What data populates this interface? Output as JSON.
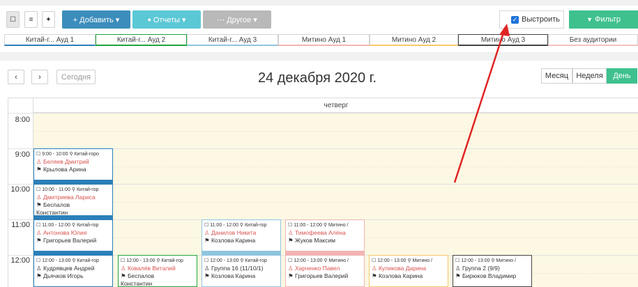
{
  "toolbar": {
    "view_icons": [
      "calendar-grid-icon",
      "list-icon",
      "graduation-icon"
    ],
    "add_label": "+ Добавить ▾",
    "reports_label": "Отчеты ▾",
    "other_label": "⋯ Другое ▾",
    "build_label": "Выстроить",
    "build_checked": true,
    "filter_label": "Фильтр"
  },
  "rooms": [
    {
      "label": "Китай-г... Ауд 1",
      "color": "#2c7fb8"
    },
    {
      "label": "Китай-г... Ауд 2",
      "color": "#1fa53b"
    },
    {
      "label": "Китай-г... Ауд 3",
      "color": "#8fc5e0"
    },
    {
      "label": "Митино Ауд 1",
      "color": "#f3b3b3"
    },
    {
      "label": "Митино Ауд 2",
      "color": "#f6c86a"
    },
    {
      "label": "Митино Ауд 3",
      "color": "#444444"
    },
    {
      "label": "Без аудитории",
      "color": "#f3c1c1"
    }
  ],
  "calendar": {
    "prev": "‹",
    "next": "›",
    "today_label": "Сегодня",
    "title": "24 декабря 2020 г.",
    "views": [
      "Месяц",
      "Неделя",
      "День"
    ],
    "active_view": "День",
    "day_label": "четверг",
    "hours": [
      "8:00",
      "9:00",
      "10:00",
      "11:00",
      "12:00"
    ]
  },
  "events": [
    {
      "time": "9:00 - 10:00 ⚲ Китай-горо",
      "teacher": "Беляев Дмитрий",
      "student": "Крылова Арина",
      "student2": "",
      "color": "#2c7fb8",
      "hour": 1,
      "col": 0
    },
    {
      "time": "10:00 - 11:00 ⚲ Китай-гор",
      "teacher": "Дмитриева Лариса",
      "student": "Беспалов",
      "student2": "Константин",
      "color": "#2c7fb8",
      "hour": 2,
      "col": 0
    },
    {
      "time": "11:00 - 12:00 ⚲ Китай-гор",
      "teacher": "Антонова Юлия",
      "student": "Григорьев Валерий",
      "student2": "",
      "color": "#2c7fb8",
      "hour": 3,
      "col": 0
    },
    {
      "time": "11:00 - 12:00 ⚲ Китай-гор",
      "teacher": "Данилов Никита",
      "student": "Козлова Карина",
      "student2": "",
      "color": "#8fc5e0",
      "hour": 3,
      "col": 2
    },
    {
      "time": "11:00 - 12:00 ⚲ Митино /",
      "teacher": "Тимофеева Алёна",
      "student": "Жуков Максим",
      "student2": "",
      "color": "#f3b3b3",
      "hour": 3,
      "col": 3
    },
    {
      "time": "12:00 - 13:00 ⚲ Китай-гор",
      "teacher": "Кудрявцев Андрей",
      "student": "Дьячков Игорь",
      "student2": "",
      "color": "#2c7fb8",
      "hour": 4,
      "col": 0,
      "teacher_plain": true
    },
    {
      "time": "12:00 - 13:00 ⚲ Китай-гор",
      "teacher": "Ковалёв Виталий",
      "student": "Беспалов",
      "student2": "Константин",
      "color": "#1fa53b",
      "hour": 4,
      "col": 1
    },
    {
      "time": "12:00 - 13:00 ⚲ Китай-гор",
      "teacher": "Группа 16 (11/10/1)",
      "student": "Козлова Карина",
      "student2": "",
      "color": "#8fc5e0",
      "hour": 4,
      "col": 2,
      "teacher_plain": true
    },
    {
      "time": "12:00 - 13:00 ⚲ Митино /",
      "teacher": "Харченко Павел",
      "student": "Григорьев Валерий",
      "student2": "",
      "color": "#f3b3b3",
      "hour": 4,
      "col": 3
    },
    {
      "time": "12:00 - 13:00 ⚲ Митино /",
      "teacher": "Куликова Дарина",
      "student": "Козлова Карина",
      "student2": "",
      "color": "#f6c86a",
      "hour": 4,
      "col": 4
    },
    {
      "time": "12:00 - 13:00 ⚲ Митино /",
      "teacher": "Группа 2 (9/9)",
      "student": "Бирюков Владимир",
      "student2": "",
      "color": "#444444",
      "hour": 4,
      "col": 5,
      "teacher_plain": true
    }
  ]
}
